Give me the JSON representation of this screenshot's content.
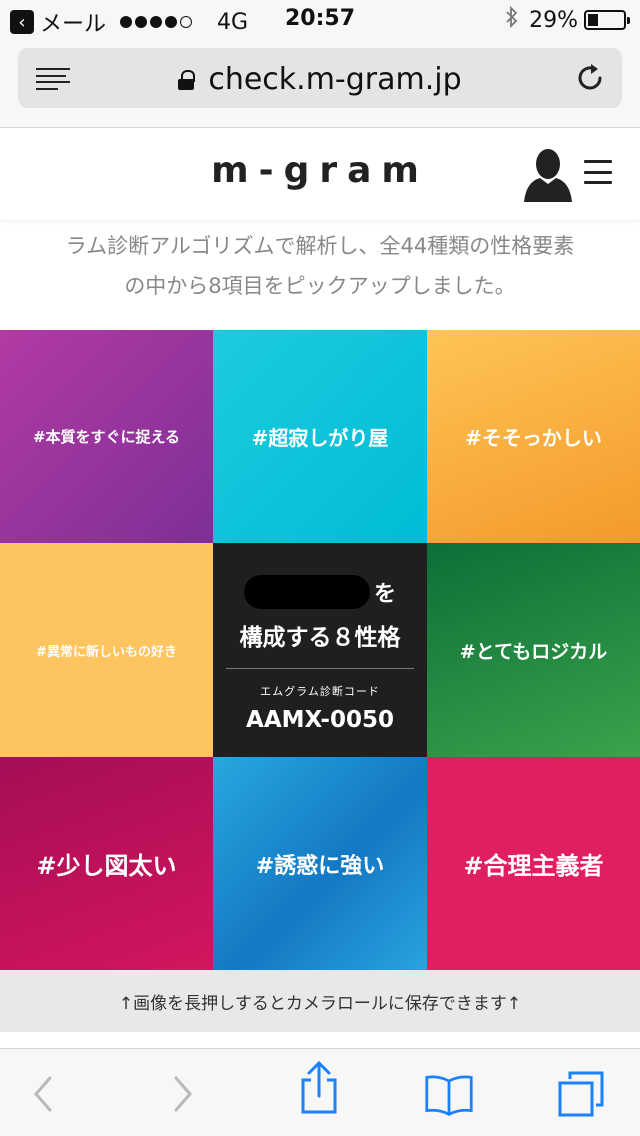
{
  "status_bar": {
    "back_label": "‹",
    "carrier": "メール",
    "network": "4G",
    "time": "20:57",
    "battery_percent_text": "29%",
    "battery_level": 0.29
  },
  "browser": {
    "url": "check.m-gram.jp"
  },
  "site": {
    "logo": "m-gram"
  },
  "intro": {
    "line1": "ラム診断アルゴリズムで解析し、全44種類の性格要素",
    "line2": "の中から8項目をピックアップしました。"
  },
  "traits": [
    "#本質をすぐに捉える",
    "#超寂しがり屋",
    "#そそっかしい",
    "#異常に新しいもの好き",
    "#とてもロジカル",
    "#少し図太い",
    "#誘惑に強い",
    "#合理主義者"
  ],
  "center": {
    "suffix": "を",
    "title": "構成する８性格",
    "code_label": "エムグラム診断コード",
    "code": "AAMX-0050"
  },
  "save_note": "↑画像を長押しするとカメラロールに保存できます↑",
  "colors": {
    "accent": "#1a82fb",
    "disabled": "#b8b8bd"
  }
}
